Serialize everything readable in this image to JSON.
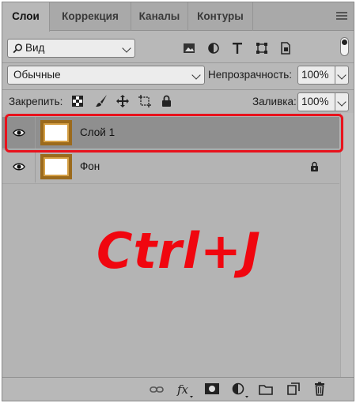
{
  "tabs": [
    {
      "label": "Слои",
      "active": true
    },
    {
      "label": "Коррекция",
      "active": false
    },
    {
      "label": "Каналы",
      "active": false
    },
    {
      "label": "Контуры",
      "active": false
    }
  ],
  "filter": {
    "kind_label": "Вид",
    "icons": [
      "image-filter-icon",
      "adjustment-filter-icon",
      "type-filter-icon",
      "shape-filter-icon",
      "smart-object-filter-icon"
    ]
  },
  "blend": {
    "mode": "Обычные",
    "opacity_label": "Непрозрачность:",
    "opacity_value": "100%"
  },
  "lock": {
    "label": "Закрепить:",
    "icons": [
      "lock-transparency-icon",
      "lock-brush-icon",
      "lock-move-icon",
      "lock-artboard-icon",
      "lock-all-icon"
    ],
    "fill_label": "Заливка:",
    "fill_value": "100%"
  },
  "layers": [
    {
      "name": "Слой 1",
      "selected": true,
      "locked": false
    },
    {
      "name": "Фон",
      "selected": false,
      "locked": true
    }
  ],
  "overlay_text": "Ctrl+J",
  "colors": {
    "highlight": "#e8121c",
    "overlay": "#f0060f"
  },
  "bottom_icons": [
    "link-layers-icon",
    "fx-icon",
    "layer-mask-icon",
    "adjustment-layer-icon",
    "group-folder-icon",
    "new-layer-icon",
    "trash-icon"
  ]
}
